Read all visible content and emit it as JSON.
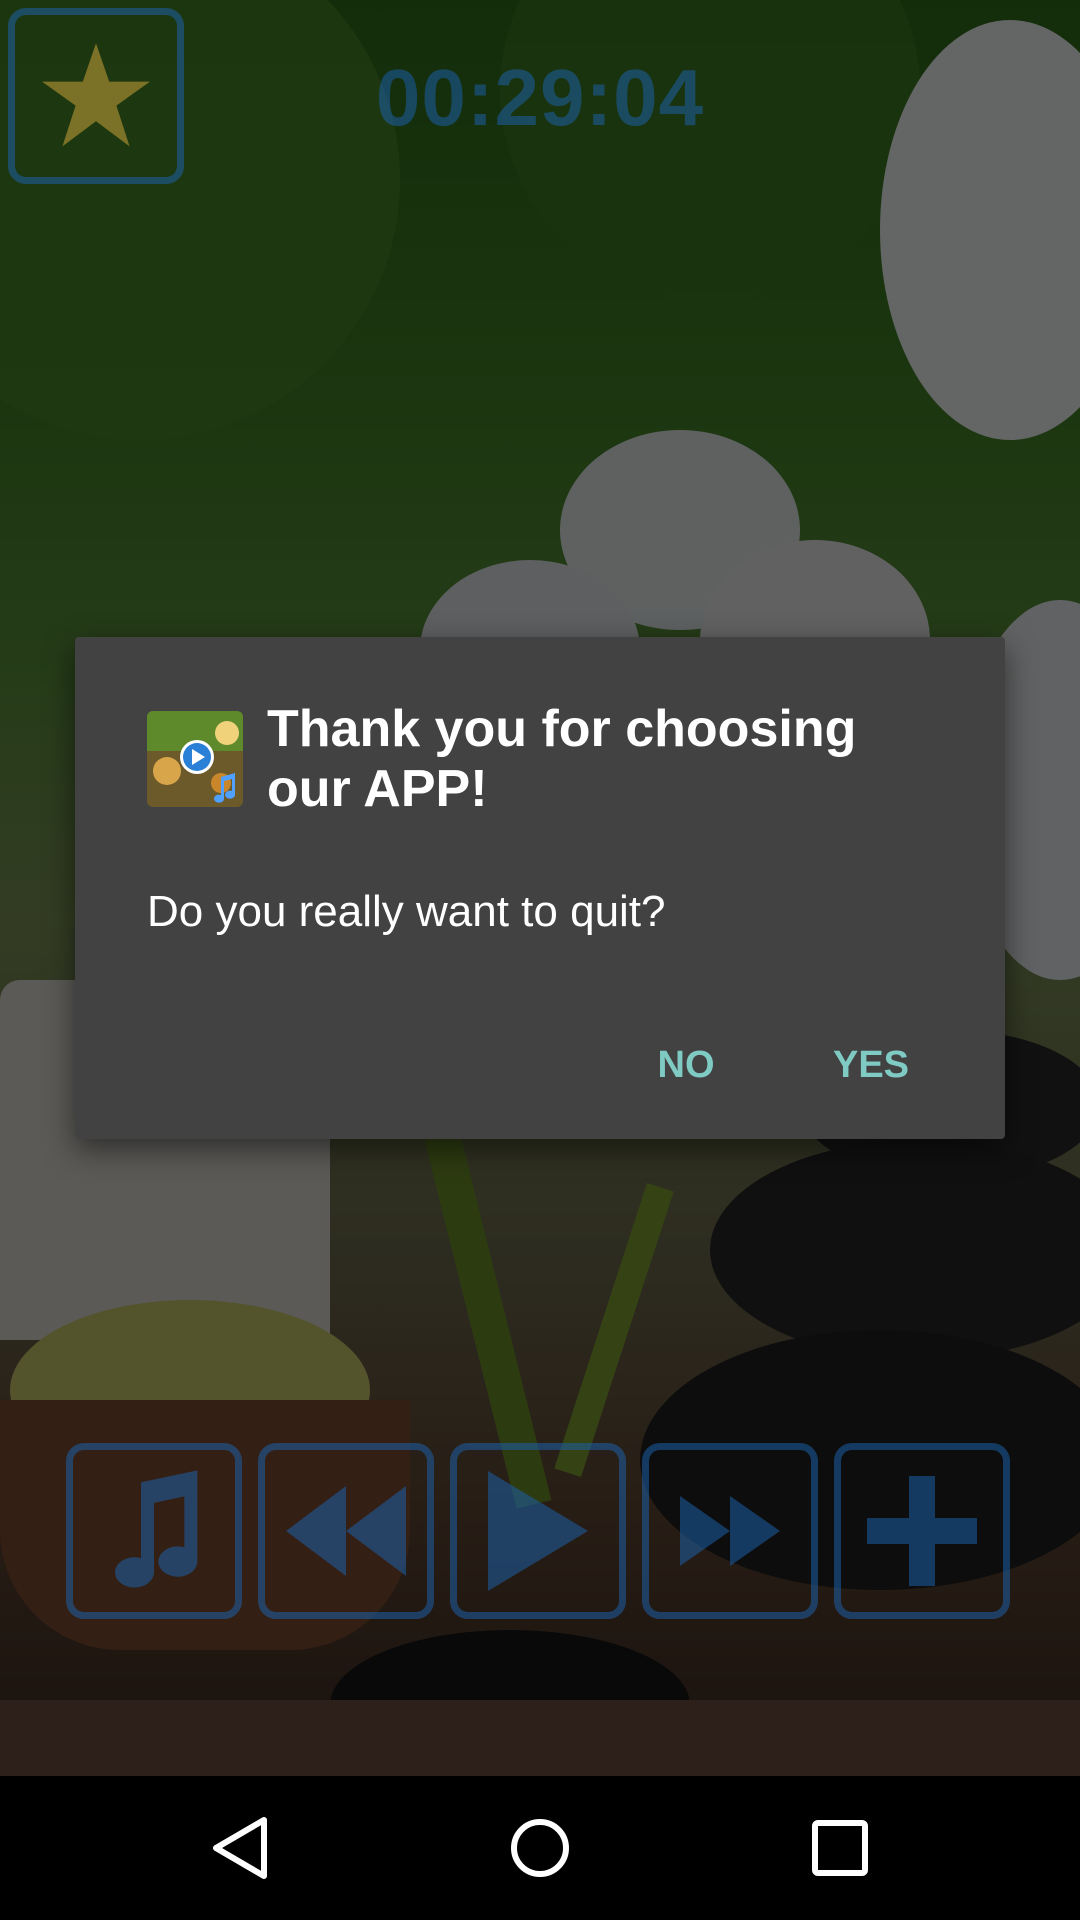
{
  "timer": {
    "value": "00:29:04"
  },
  "dialog": {
    "title": "Thank you for choosing our APP!",
    "message": "Do you really want to quit?",
    "buttons": {
      "no": "NO",
      "yes": "YES"
    }
  },
  "controls": {
    "items": [
      {
        "name": "playlist",
        "icon": "music-note-icon"
      },
      {
        "name": "previous",
        "icon": "rewind-icon"
      },
      {
        "name": "play",
        "icon": "play-icon"
      },
      {
        "name": "next",
        "icon": "fast-forward-icon"
      },
      {
        "name": "add",
        "icon": "plus-icon"
      }
    ]
  },
  "colors": {
    "control_accent": "#1c5fa6",
    "dialog_bg": "#424242",
    "dialog_button": "#7fcbc4",
    "favorite_star": "#c9a13a"
  },
  "nav": {
    "items": [
      "back-icon",
      "home-icon",
      "recent-apps-icon"
    ]
  }
}
